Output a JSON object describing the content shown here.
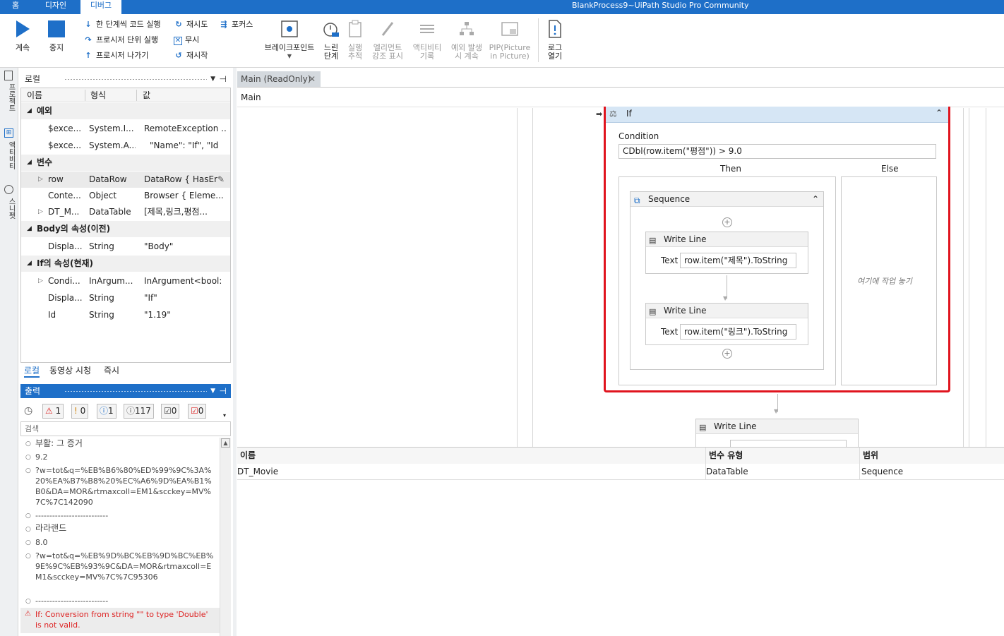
{
  "titlebar": {
    "tabs": [
      "홈",
      "디자인",
      "디버그"
    ],
    "active_tab": "디버그",
    "app_title": "BlankProcess9~UiPath Studio Pro Community"
  },
  "ribbon": {
    "continue": "계속",
    "stop": "중지",
    "step_into": "한 단계씩 코드 실행",
    "step_over": "프로시저 단위 실행",
    "step_out": "프로시저 나가기",
    "retry": "재시도",
    "ignore": "무시",
    "restart": "재시작",
    "focus": "포커스",
    "breakpoints": "브레이크포인트",
    "slow_step_1": "느린",
    "slow_step_2": "단계",
    "execution_trail_1": "실행",
    "execution_trail_2": "추적",
    "highlight_1": "엘리먼트",
    "highlight_2": "강조 표시",
    "log_activities_1": "액티비티",
    "log_activities_2": "기록",
    "continue_on_exception_1": "예외 발생",
    "continue_on_exception_2": "시 계속",
    "pip_1": "PIP(Picture",
    "pip_2": "in Picture)",
    "open_logs_1": "로그",
    "open_logs_2": "열기"
  },
  "sidebar_tabs": [
    "프로젝트",
    "액티비티",
    "스니펫"
  ],
  "locals": {
    "title": "로컬",
    "columns": [
      "이름",
      "형식",
      "값"
    ],
    "groups": {
      "exception": "예외",
      "variables": "변수",
      "body_props": "Body의 속성(이전)",
      "if_props": "If의 속성(현재)"
    },
    "rows": [
      {
        "name": "$exce...",
        "type": "System.I...",
        "value": "RemoteException ..."
      },
      {
        "name": "$exce...",
        "type": "System.A...",
        "value": "\"Name\": \"If\",  \"Id"
      },
      {
        "name": "row",
        "type": "DataRow",
        "value": "DataRow { HasEr..."
      },
      {
        "name": "Conte...",
        "type": "Object",
        "value": "Browser { Eleme..."
      },
      {
        "name": "DT_M...",
        "type": "DataTable",
        "value": "[제목,링크,평점..."
      },
      {
        "name": "Displa...",
        "type": "String",
        "value": "\"Body\""
      },
      {
        "name": "Condi...",
        "type": "InArgum...",
        "value": "InArgument<bool:"
      },
      {
        "name": "Displa...",
        "type": "String",
        "value": "\"If\""
      },
      {
        "name": "Id",
        "type": "String",
        "value": "\"1.19\""
      }
    ]
  },
  "bottom_tabs": [
    "로컬",
    "동영상 시청",
    "즉시"
  ],
  "output": {
    "title": "출력",
    "filters": [
      "1",
      "0",
      "1",
      "117",
      "0",
      "0"
    ],
    "search_placeholder": "검색",
    "lines": [
      "부활: 그 증거",
      "9.2",
      "?w=tot&q=%EB%B6%80%ED%99%9C%3A%20%EA%B7%B8%20%EC%A6%9D%EA%B1%B0&DA=MOR&rtmaxcoll=EM1&scckey=MV%7C%7C142090",
      "--------------------------",
      "라라랜드",
      "8.0",
      "?w=tot&q=%EB%9D%BC%EB%9D%BC%EB%9E%9C%EB%93%9C&DA=MOR&rtmaxcoll=EM1&scckey=MV%7C%7C95306",
      "--------------------------"
    ],
    "error": "If: Conversion from string \"\" to type 'Double' is not valid."
  },
  "designer": {
    "doc_tab": "Main (ReadOnly)",
    "breadcrumb": "Main",
    "if": {
      "title": "If",
      "condition_label": "Condition",
      "condition": "CDbl(row.item(\"평점\")) > 9.0",
      "then_label": "Then",
      "else_label": "Else",
      "else_placeholder": "여기에 작업 놓기"
    },
    "sequence_title": "Sequence",
    "writeline1": {
      "title": "Write Line",
      "text_label": "Text",
      "value": "row.item(\"제목\").ToString"
    },
    "writeline2": {
      "title": "Write Line",
      "text_label": "Text",
      "value": "row.item(\"링크\").ToString"
    },
    "writeline3": {
      "title": "Write Line"
    }
  },
  "variables": {
    "columns": [
      "이름",
      "변수 유형",
      "범위"
    ],
    "rows": [
      {
        "name": "DT_Movie",
        "type": "DataTable",
        "scope": "Sequence"
      }
    ]
  },
  "colors": {
    "accent": "#1e6fc8",
    "highlight_border": "#e0141e",
    "if_header": "#d6e6f5"
  }
}
